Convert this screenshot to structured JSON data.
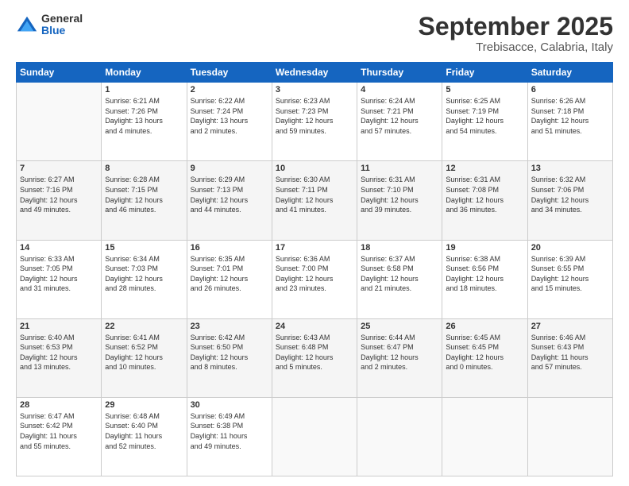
{
  "logo": {
    "general": "General",
    "blue": "Blue"
  },
  "header": {
    "month": "September 2025",
    "location": "Trebisacce, Calabria, Italy"
  },
  "weekdays": [
    "Sunday",
    "Monday",
    "Tuesday",
    "Wednesday",
    "Thursday",
    "Friday",
    "Saturday"
  ],
  "weeks": [
    [
      {
        "day": "",
        "info": ""
      },
      {
        "day": "1",
        "info": "Sunrise: 6:21 AM\nSunset: 7:26 PM\nDaylight: 13 hours\nand 4 minutes."
      },
      {
        "day": "2",
        "info": "Sunrise: 6:22 AM\nSunset: 7:24 PM\nDaylight: 13 hours\nand 2 minutes."
      },
      {
        "day": "3",
        "info": "Sunrise: 6:23 AM\nSunset: 7:23 PM\nDaylight: 12 hours\nand 59 minutes."
      },
      {
        "day": "4",
        "info": "Sunrise: 6:24 AM\nSunset: 7:21 PM\nDaylight: 12 hours\nand 57 minutes."
      },
      {
        "day": "5",
        "info": "Sunrise: 6:25 AM\nSunset: 7:19 PM\nDaylight: 12 hours\nand 54 minutes."
      },
      {
        "day": "6",
        "info": "Sunrise: 6:26 AM\nSunset: 7:18 PM\nDaylight: 12 hours\nand 51 minutes."
      }
    ],
    [
      {
        "day": "7",
        "info": "Sunrise: 6:27 AM\nSunset: 7:16 PM\nDaylight: 12 hours\nand 49 minutes."
      },
      {
        "day": "8",
        "info": "Sunrise: 6:28 AM\nSunset: 7:15 PM\nDaylight: 12 hours\nand 46 minutes."
      },
      {
        "day": "9",
        "info": "Sunrise: 6:29 AM\nSunset: 7:13 PM\nDaylight: 12 hours\nand 44 minutes."
      },
      {
        "day": "10",
        "info": "Sunrise: 6:30 AM\nSunset: 7:11 PM\nDaylight: 12 hours\nand 41 minutes."
      },
      {
        "day": "11",
        "info": "Sunrise: 6:31 AM\nSunset: 7:10 PM\nDaylight: 12 hours\nand 39 minutes."
      },
      {
        "day": "12",
        "info": "Sunrise: 6:31 AM\nSunset: 7:08 PM\nDaylight: 12 hours\nand 36 minutes."
      },
      {
        "day": "13",
        "info": "Sunrise: 6:32 AM\nSunset: 7:06 PM\nDaylight: 12 hours\nand 34 minutes."
      }
    ],
    [
      {
        "day": "14",
        "info": "Sunrise: 6:33 AM\nSunset: 7:05 PM\nDaylight: 12 hours\nand 31 minutes."
      },
      {
        "day": "15",
        "info": "Sunrise: 6:34 AM\nSunset: 7:03 PM\nDaylight: 12 hours\nand 28 minutes."
      },
      {
        "day": "16",
        "info": "Sunrise: 6:35 AM\nSunset: 7:01 PM\nDaylight: 12 hours\nand 26 minutes."
      },
      {
        "day": "17",
        "info": "Sunrise: 6:36 AM\nSunset: 7:00 PM\nDaylight: 12 hours\nand 23 minutes."
      },
      {
        "day": "18",
        "info": "Sunrise: 6:37 AM\nSunset: 6:58 PM\nDaylight: 12 hours\nand 21 minutes."
      },
      {
        "day": "19",
        "info": "Sunrise: 6:38 AM\nSunset: 6:56 PM\nDaylight: 12 hours\nand 18 minutes."
      },
      {
        "day": "20",
        "info": "Sunrise: 6:39 AM\nSunset: 6:55 PM\nDaylight: 12 hours\nand 15 minutes."
      }
    ],
    [
      {
        "day": "21",
        "info": "Sunrise: 6:40 AM\nSunset: 6:53 PM\nDaylight: 12 hours\nand 13 minutes."
      },
      {
        "day": "22",
        "info": "Sunrise: 6:41 AM\nSunset: 6:52 PM\nDaylight: 12 hours\nand 10 minutes."
      },
      {
        "day": "23",
        "info": "Sunrise: 6:42 AM\nSunset: 6:50 PM\nDaylight: 12 hours\nand 8 minutes."
      },
      {
        "day": "24",
        "info": "Sunrise: 6:43 AM\nSunset: 6:48 PM\nDaylight: 12 hours\nand 5 minutes."
      },
      {
        "day": "25",
        "info": "Sunrise: 6:44 AM\nSunset: 6:47 PM\nDaylight: 12 hours\nand 2 minutes."
      },
      {
        "day": "26",
        "info": "Sunrise: 6:45 AM\nSunset: 6:45 PM\nDaylight: 12 hours\nand 0 minutes."
      },
      {
        "day": "27",
        "info": "Sunrise: 6:46 AM\nSunset: 6:43 PM\nDaylight: 11 hours\nand 57 minutes."
      }
    ],
    [
      {
        "day": "28",
        "info": "Sunrise: 6:47 AM\nSunset: 6:42 PM\nDaylight: 11 hours\nand 55 minutes."
      },
      {
        "day": "29",
        "info": "Sunrise: 6:48 AM\nSunset: 6:40 PM\nDaylight: 11 hours\nand 52 minutes."
      },
      {
        "day": "30",
        "info": "Sunrise: 6:49 AM\nSunset: 6:38 PM\nDaylight: 11 hours\nand 49 minutes."
      },
      {
        "day": "",
        "info": ""
      },
      {
        "day": "",
        "info": ""
      },
      {
        "day": "",
        "info": ""
      },
      {
        "day": "",
        "info": ""
      }
    ]
  ]
}
